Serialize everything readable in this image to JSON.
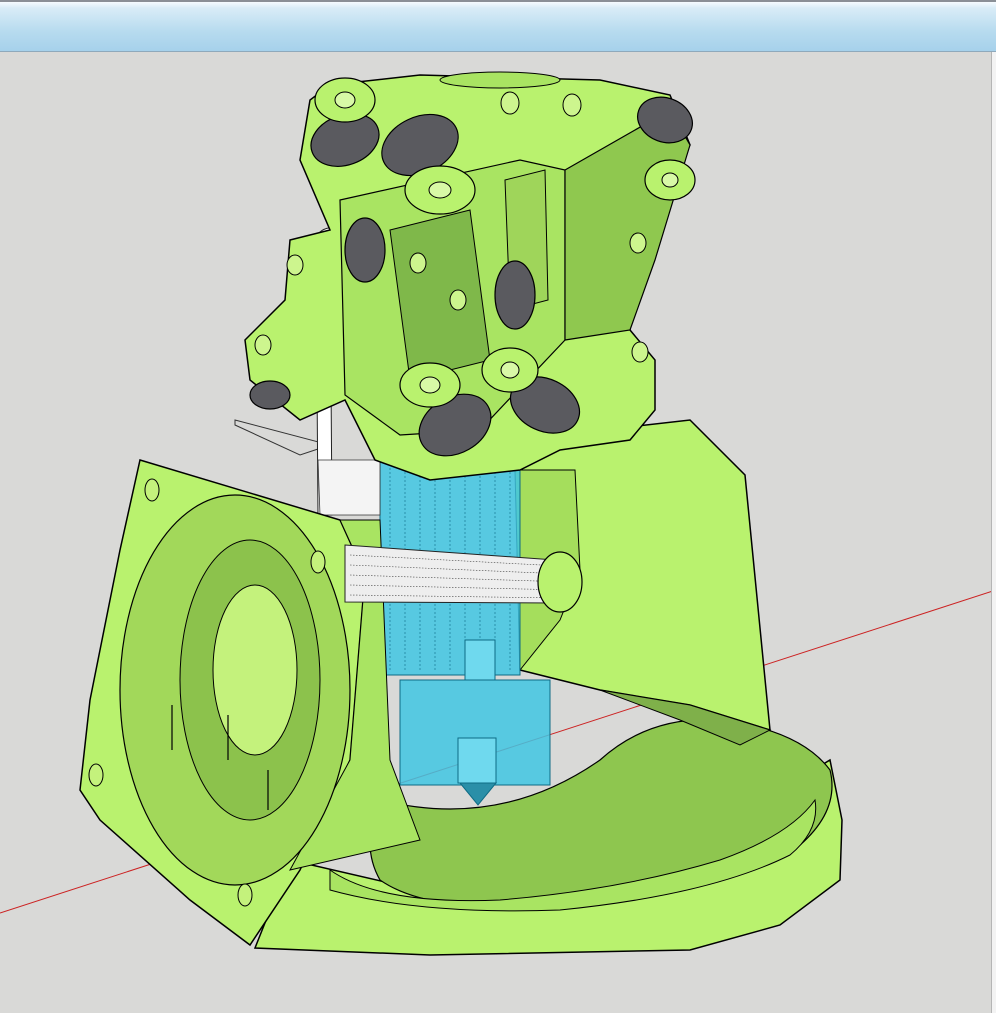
{
  "window": {
    "title": ""
  },
  "viewport": {
    "background_color": "#d9d9d7",
    "model": {
      "parts": [
        {
          "name": "carriage-body",
          "color": "#b9f26e"
        },
        {
          "name": "roller-wheels",
          "color": "#5a5a5f"
        },
        {
          "name": "hotend-heatsink",
          "color": "#3fc6e3"
        },
        {
          "name": "heater-block",
          "color": "#3fc6e3"
        },
        {
          "name": "filament-tube",
          "color": "#ffffff"
        },
        {
          "name": "fan-duct",
          "color": "#b9f26e"
        },
        {
          "name": "threaded-rod",
          "color": "#e8e8e8"
        }
      ],
      "axis_color": "#cc2222",
      "edge_color": "#000000"
    }
  }
}
